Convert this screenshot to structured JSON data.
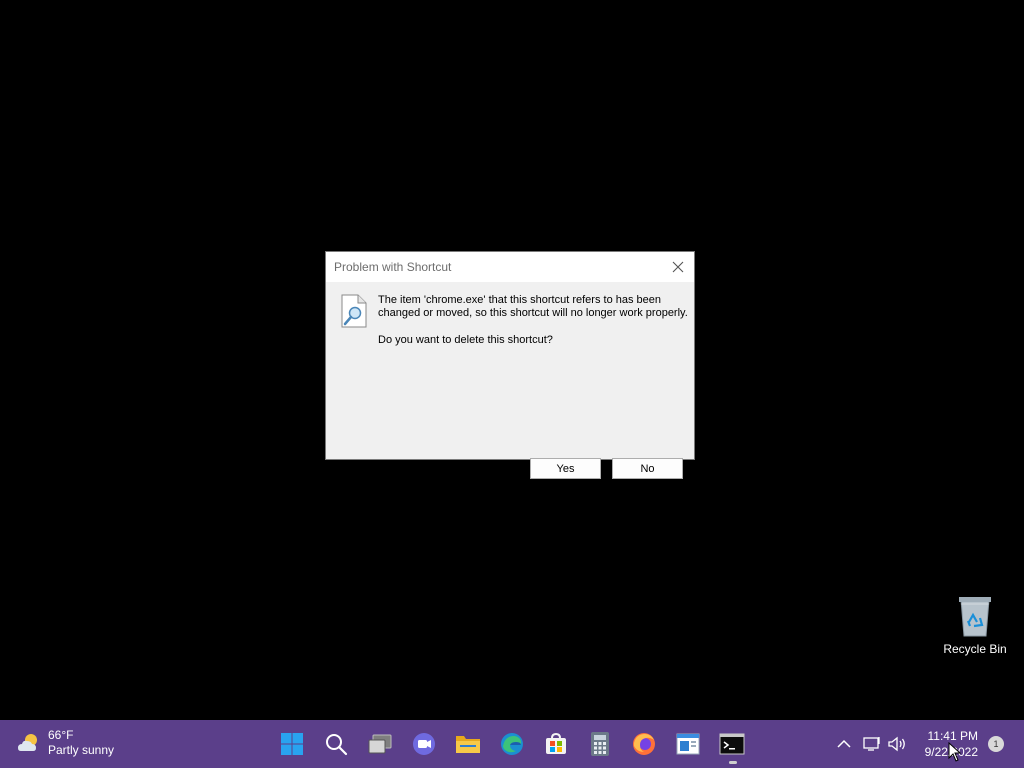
{
  "dialog": {
    "title": "Problem with Shortcut",
    "message_line1": "The item 'chrome.exe' that this shortcut refers to has been",
    "message_line2": "changed or moved, so this shortcut will no longer work properly.",
    "question": "Do you want to delete this shortcut?",
    "yes_label": "Yes",
    "no_label": "No",
    "icons": {
      "close": "close-icon",
      "document": "document-magnifier-icon"
    }
  },
  "desktop": {
    "icons": [
      {
        "label": "Recycle Bin",
        "icon": "recycle-bin-icon"
      }
    ]
  },
  "taskbar": {
    "weather": {
      "temp": "66°F",
      "condition": "Partly sunny",
      "icon": "partly-sunny-icon"
    },
    "pinned": [
      {
        "name": "start-button",
        "icon": "windows-logo-icon"
      },
      {
        "name": "search-button",
        "icon": "search-icon"
      },
      {
        "name": "task-view-button",
        "icon": "task-view-icon"
      },
      {
        "name": "teams-chat-button",
        "icon": "chat-icon"
      },
      {
        "name": "file-explorer-button",
        "icon": "folder-icon"
      },
      {
        "name": "edge-button",
        "icon": "edge-icon"
      },
      {
        "name": "store-button",
        "icon": "store-icon"
      },
      {
        "name": "calculator-button",
        "icon": "calculator-icon"
      },
      {
        "name": "firefox-button",
        "icon": "firefox-icon"
      },
      {
        "name": "notepad-button",
        "icon": "notepad-icon"
      },
      {
        "name": "terminal-button",
        "icon": "terminal-icon"
      }
    ],
    "tray": {
      "time": "11:41 PM",
      "date": "9/22/2022",
      "notification_count": "1"
    },
    "colors": {
      "taskbar_bg": "#5b3f8a"
    }
  }
}
